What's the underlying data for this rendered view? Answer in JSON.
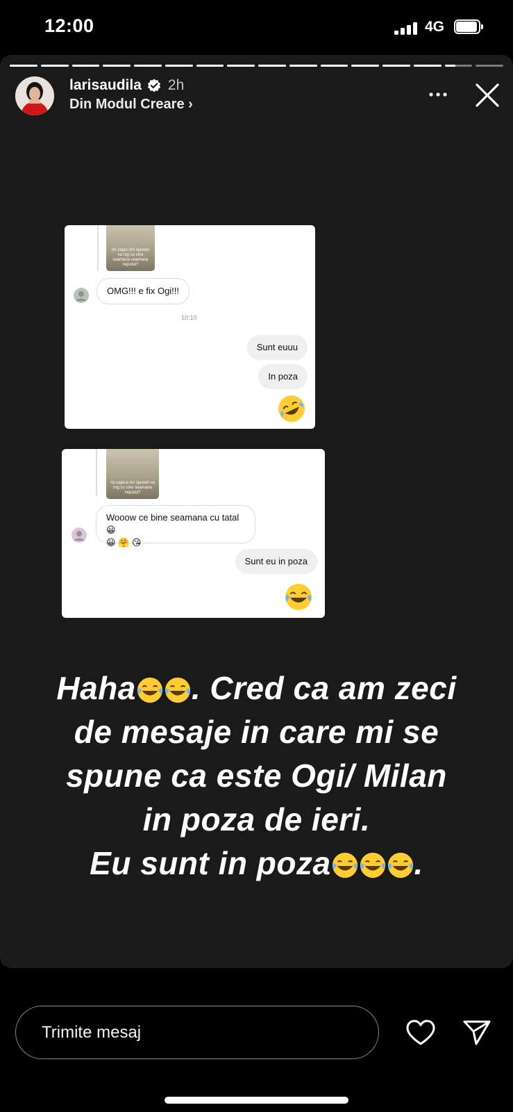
{
  "status_bar": {
    "time": "12:00",
    "network": "4G"
  },
  "story": {
    "segments_total": 16,
    "current_segment": 15,
    "current_segment_progress": 0.4,
    "username": "larisaudila",
    "time_ago": "2h",
    "subtitle": "Din Modul Creare ›"
  },
  "screenshot1": {
    "thumb_caption": "mi-zapici imi spuneti va rog cu cine seamana seamana nepotul?",
    "incoming_message": "OMG!!! e fix Ogi!!!",
    "timestamp": "10:10",
    "outgoing_messages": [
      "Sunt euuu",
      "In poza"
    ]
  },
  "screenshot2": {
    "thumb_caption": "mi-zapica imi spuneti va rog cu cine seamana nepotul?",
    "incoming_message": "Wooow ce bine seamana cu tatal",
    "outgoing_message": "Sunt eu in poza"
  },
  "caption": {
    "line1_text": "Haha",
    "line1_rest": ". Cred ca am zeci",
    "line2": "de mesaje in care mi se",
    "line3": "spune ca este Ogi/ Milan",
    "line4": "in poza de ieri.",
    "line5_text": "Eu sunt in poza",
    "line5_rest": "."
  },
  "bottom": {
    "message_placeholder": "Trimite mesaj"
  }
}
